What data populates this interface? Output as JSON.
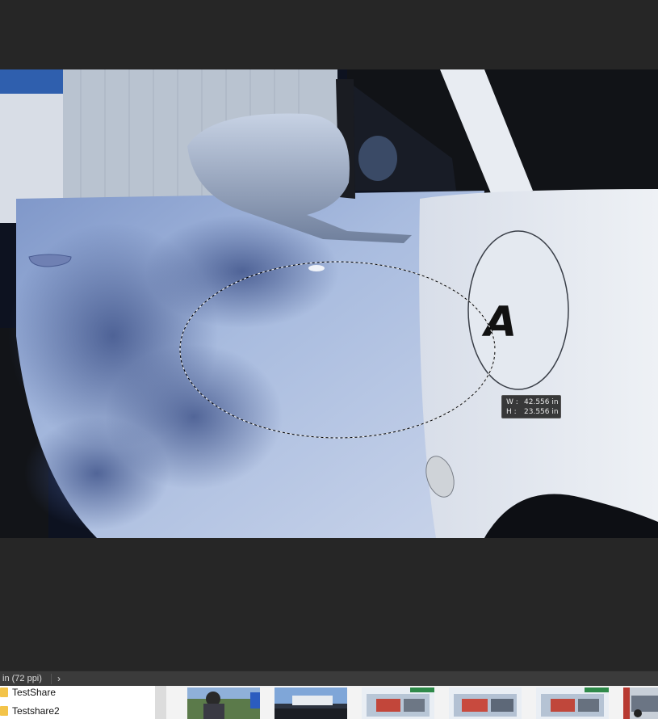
{
  "image": {
    "selection_readout": {
      "width_label": "W :",
      "width_value": "42.556 in",
      "height_label": "H :",
      "height_value": "23.556 in"
    }
  },
  "status_bar": {
    "resolution": "in (72 ppi)",
    "chevron_icon": "chevron-right-icon"
  },
  "file_browser": {
    "folders": [
      {
        "label": "TestShare",
        "icon": "folder-icon"
      },
      {
        "label": "Testshare2",
        "icon": "folder-icon"
      }
    ],
    "thumbnails": [
      "photo-thumbnail",
      "photo-thumbnail",
      "photo-thumbnail",
      "photo-thumbnail",
      "photo-thumbnail",
      "photo-thumbnail"
    ]
  },
  "colors": {
    "workspace_bg": "#262626",
    "status_bar_bg": "#3b3b3b",
    "folder_icon": "#f3c44a"
  }
}
